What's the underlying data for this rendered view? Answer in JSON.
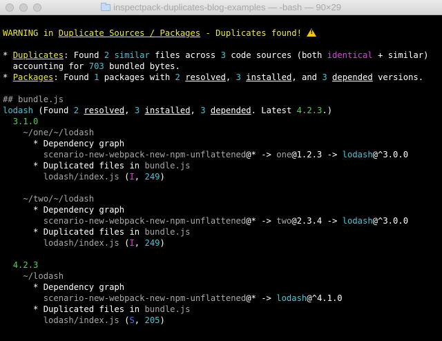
{
  "window": {
    "title": "inspectpack-duplicates-blog-examples — -bash — 90×29"
  },
  "header": {
    "warning_prefix": "WARNING in ",
    "warning_link": "Duplicate Sources / Packages",
    "warning_suffix": " - Duplicates found! "
  },
  "summary": {
    "dup_bullet": "* ",
    "dup_label": "Duplicates",
    "dup_text1": ": Found ",
    "dup_count": "2",
    "dup_similar": "similar",
    "dup_text2": " files across ",
    "dup_sources": "3",
    "dup_text3": " code sources (both ",
    "dup_identical": "identical",
    "dup_text4": " + similar)",
    "dup_line2_a": "  accounting for ",
    "dup_bytes": "703",
    "dup_line2_b": " bundled bytes.",
    "pkg_bullet": "* ",
    "pkg_label": "Packages",
    "pkg_text1": ": Found ",
    "pkg_count": "1",
    "pkg_text2": " packages with ",
    "pkg_resolved_n": "2",
    "pkg_resolved": "resolved",
    "pkg_installed_n": "3",
    "pkg_installed": "installed",
    "pkg_and": ", and ",
    "pkg_depended_n": "3",
    "pkg_depended": "depended",
    "pkg_end": " versions."
  },
  "bundle": {
    "header": "## bundle.js",
    "pkg_name": "lodash",
    "pkg_found": " (Found ",
    "resolved_n": "2",
    "resolved": "resolved",
    "installed_n": "3",
    "installed": "installed",
    "depended_n": "3",
    "depended": "depended",
    "latest_label": ". Latest ",
    "latest": "4.2.3",
    "latest_end": ".)"
  },
  "tree": {
    "v1": "3.1.0",
    "p1_path": "~/one/~/lodash",
    "dep_graph": "* Dependency graph",
    "dup_files": "* Duplicated files in ",
    "bundle_file": "bundle.js",
    "scenario": "scenario-new-webpack-new-npm-unflattened",
    "at_star": "@* -> ",
    "arrow": " -> ",
    "p1_mid_name": "one",
    "p1_mid_ver": "@1.2.3",
    "lodash": "lodash",
    "p1_ver": "@^3.0.0",
    "file": "lodash/index.js",
    "p1_type": "I",
    "p1_size": "249",
    "p2_path": "~/two/~/lodash",
    "p2_mid_name": "two",
    "p2_mid_ver": "@2.3.4",
    "p2_ver": "@^3.0.0",
    "p2_type": "I",
    "p2_size": "249",
    "v2": "4.2.3",
    "p3_path": "~/lodash",
    "p3_ver": "@^4.1.0",
    "p3_type": "S",
    "p3_size": "205",
    "paren_open": " (",
    "comma": ", ",
    "paren_close": ")"
  }
}
